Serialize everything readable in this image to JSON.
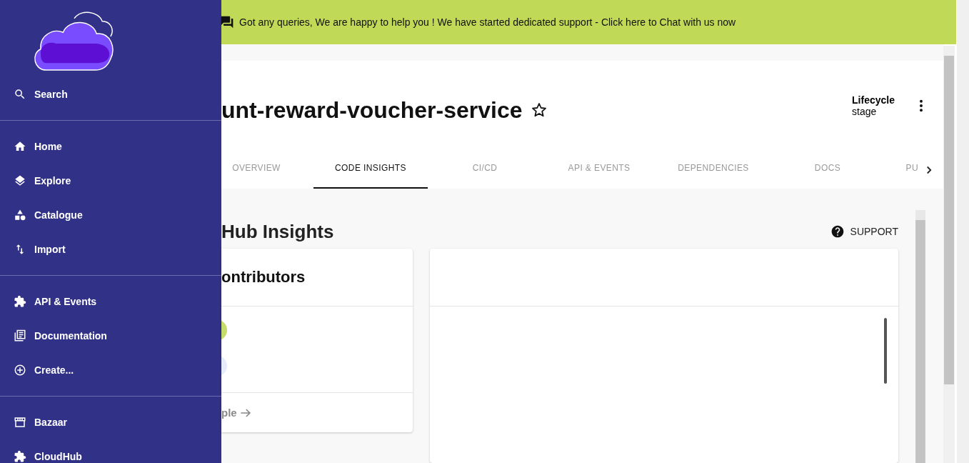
{
  "sidebar": {
    "groups": [
      {
        "items": [
          {
            "label": "Search"
          }
        ]
      },
      {
        "items": [
          {
            "label": "Home"
          },
          {
            "label": "Explore"
          },
          {
            "label": "Catalogue"
          },
          {
            "label": "Import"
          }
        ]
      },
      {
        "items": [
          {
            "label": "API & Events"
          },
          {
            "label": "Documentation"
          },
          {
            "label": "Create..."
          }
        ]
      },
      {
        "items": [
          {
            "label": "Bazaar"
          },
          {
            "label": "CloudHub"
          }
        ]
      }
    ]
  },
  "banner": {
    "text": "Got any queries, We are happy to help you ! We have started dedicated support - Click here to Chat with us now"
  },
  "header": {
    "title": "unt-reward-voucher-service",
    "starred": false,
    "lifecycle_label": "Lifecycle",
    "lifecycle_value": "stage"
  },
  "tabs": [
    {
      "label": "OVERVIEW",
      "selected": false
    },
    {
      "label": "CODE INSIGHTS",
      "selected": true
    },
    {
      "label": "CI/CD",
      "selected": false
    },
    {
      "label": "API & EVENTS",
      "selected": false
    },
    {
      "label": "DEPENDENCIES",
      "selected": false
    },
    {
      "label": "DOCS",
      "selected": false
    },
    {
      "label": "PU",
      "selected": false
    }
  ],
  "insights": {
    "title": "Hub Insights",
    "support": "SUPPORT",
    "contributors_card": {
      "title": "ontributors",
      "footer_link": "ple"
    }
  }
}
